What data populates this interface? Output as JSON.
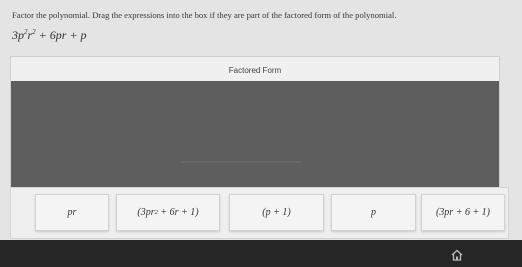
{
  "instructions": "Factor the polynomial. Drag the expressions into the box if they are part of the factored form of the polynomial.",
  "polynomial": {
    "coef": "3p",
    "exp1": "2",
    "mid": "r",
    "exp2": "2",
    "rest": "+ 6pr + p"
  },
  "drop_area": {
    "title": "Factored Form"
  },
  "chips": [
    {
      "main": "pr"
    },
    {
      "before": "(3pr",
      "sup": "2",
      "after": "+ 6r + 1)"
    },
    {
      "main": "(p + 1)"
    },
    {
      "main": "p"
    },
    {
      "main": "(3pr + 6 + 1)"
    }
  ],
  "footer": {
    "icon": "home-icon"
  },
  "colors": {
    "drop_zone": "#5e5e5e",
    "background": "#e4e4e4",
    "footer": "#262626"
  }
}
